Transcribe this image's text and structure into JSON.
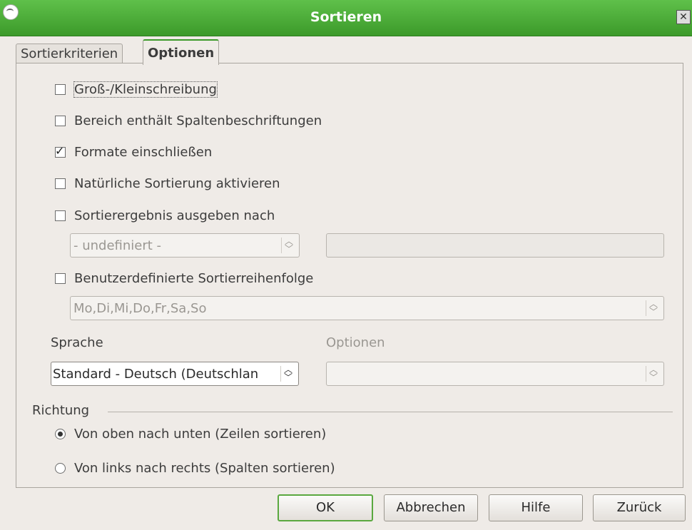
{
  "window": {
    "title": "Sortieren"
  },
  "tabs": [
    {
      "label": "Sortierkriterien",
      "active": false
    },
    {
      "label": "Optionen",
      "active": true
    }
  ],
  "options": {
    "case_sensitive": {
      "label": "Groß-/Kleinschreibung",
      "checked": false
    },
    "has_headers": {
      "label": "Bereich enthält Spaltenbeschriftungen",
      "checked": false
    },
    "include_formats": {
      "label": "Formate einschließen",
      "checked": true
    },
    "natural_sort": {
      "label": "Natürliche Sortierung aktivieren",
      "checked": false
    },
    "copy_output": {
      "label": "Sortierergebnis ausgeben nach",
      "checked": false
    },
    "output_select": {
      "value": "- undefiniert -"
    },
    "output_field": {
      "value": ""
    },
    "custom_order": {
      "label": "Benutzerdefinierte Sortierreihenfolge",
      "checked": false
    },
    "custom_order_select": {
      "value": "Mo,Di,Mi,Do,Fr,Sa,So"
    },
    "language_label": "Sprache",
    "language_select": {
      "value": "Standard - Deutsch (Deutschlan"
    },
    "algorithm_label": "Optionen",
    "algorithm_select": {
      "value": ""
    }
  },
  "direction": {
    "label": "Richtung",
    "top_to_bottom": {
      "label": "Von oben nach unten (Zeilen sortieren)",
      "selected": true
    },
    "left_to_right": {
      "label": "Von links nach rechts (Spalten sortieren)",
      "selected": false
    }
  },
  "buttons": {
    "ok": "OK",
    "cancel": "Abbrechen",
    "help": "Hilfe",
    "reset": "Zurück"
  },
  "colors": {
    "titlebar": "#4caf35",
    "accent": "#3c9a2a"
  }
}
